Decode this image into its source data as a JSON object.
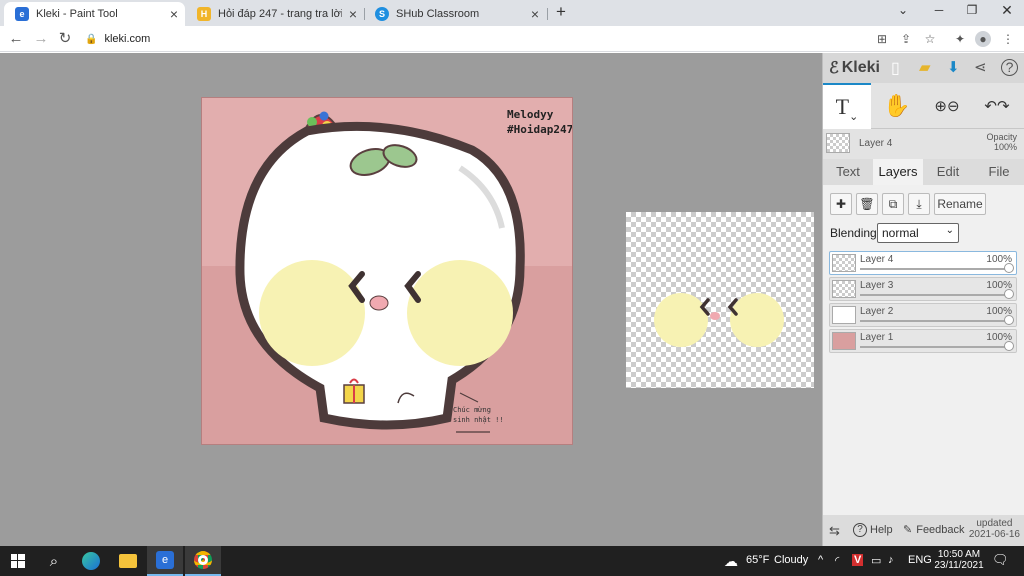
{
  "browser": {
    "tabs": [
      {
        "title": "Kleki - Paint Tool",
        "active": true,
        "favicon": "kleki-icon"
      },
      {
        "title": "Hỏi đáp 247 - trang tra lời",
        "active": false,
        "favicon": "hoidap-icon"
      },
      {
        "title": "SHub Classroom",
        "active": false,
        "favicon": "shub-icon"
      }
    ],
    "url": "kleki.com"
  },
  "artwork": {
    "signature_line1": "Melodyy",
    "signature_line2": "#Hoidap247",
    "note_line1": "Chúc mừng",
    "note_line2": "sinh nhật !!"
  },
  "panel": {
    "logo": "Kleki",
    "current_layer": "Layer 4",
    "opacity_label": "Opacity",
    "opacity_value": "100%",
    "tabs": [
      "Text",
      "Layers",
      "Edit",
      "File"
    ],
    "active_tab": "Layers",
    "rename_label": "Rename",
    "blending_label": "Blending",
    "blending_value": "normal",
    "layers": [
      {
        "name": "Layer 4",
        "opacity": "100%",
        "selected": true
      },
      {
        "name": "Layer 3",
        "opacity": "100%",
        "selected": false
      },
      {
        "name": "Layer 2",
        "opacity": "100%",
        "selected": false
      },
      {
        "name": "Layer 1",
        "opacity": "100%",
        "selected": false
      }
    ],
    "help_label": "Help",
    "feedback_label": "Feedback",
    "updated_line1": "updated",
    "updated_line2": "2021-06-16"
  },
  "taskbar": {
    "weather_temp": "65°F",
    "weather_desc": "Cloudy",
    "language": "ENG",
    "time": "10:50 AM",
    "date": "23/11/2021"
  },
  "colors": {
    "accent": "#1b88c7",
    "canvas_bg": "#e2aeae",
    "blush": "#f7f2b3"
  }
}
